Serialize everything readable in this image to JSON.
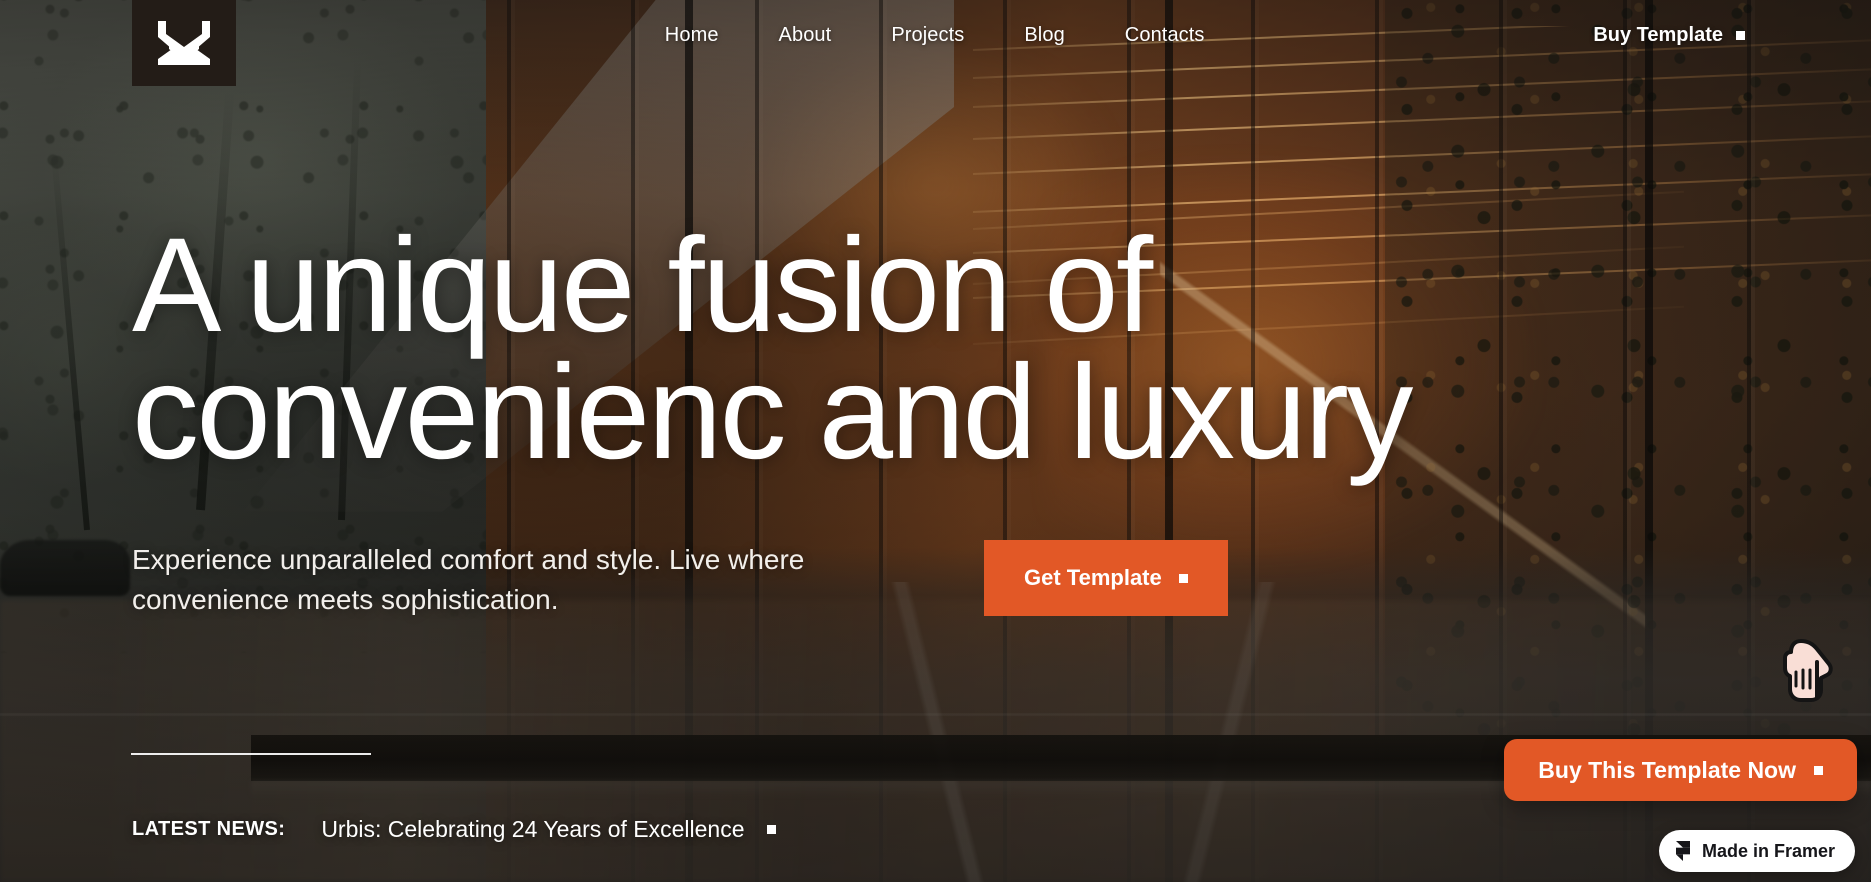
{
  "brand": {
    "logo_icon": "chevron-down-logo-icon",
    "logo_bg": "#231c17",
    "accent": "#e25826"
  },
  "header": {
    "nav": [
      {
        "label": "Home",
        "name": "nav-home"
      },
      {
        "label": "About",
        "name": "nav-about"
      },
      {
        "label": "Projects",
        "name": "nav-projects"
      },
      {
        "label": "Blog",
        "name": "nav-blog"
      },
      {
        "label": "Contacts",
        "name": "nav-contacts"
      }
    ],
    "buy_template": "Buy Template"
  },
  "hero": {
    "headline_line1": "A unique fusion of",
    "headline_line2": "convenienc and luxury",
    "subtitle": "Experience unparalleled comfort and style. Live where convenience meets sophistication.",
    "cta_label": "Get Template"
  },
  "news": {
    "label": "LATEST NEWS:",
    "headline": "Urbis: Celebrating 24 Years of Excellence"
  },
  "floating": {
    "buy_now_label": "Buy This Template Now",
    "framer_badge": "Made in Framer",
    "framer_icon": "framer-logo-icon",
    "cursor_icon": "pointing-hand-cursor-icon"
  }
}
